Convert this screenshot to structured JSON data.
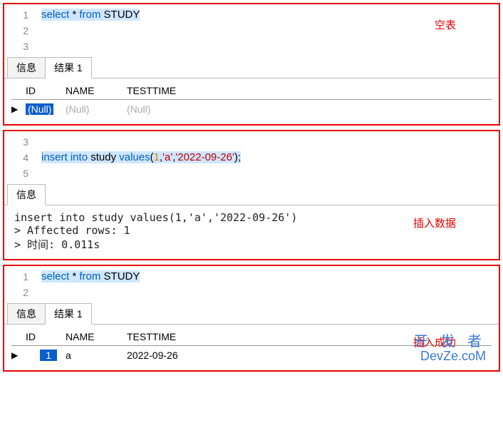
{
  "panel1": {
    "annotation": "空表",
    "sql": {
      "lines": [
        {
          "n": "1",
          "html": "<span class='sel'><span class='kw'>select</span> * <span class='kw'>from</span> STUDY</span>"
        },
        {
          "n": "2",
          "html": ""
        },
        {
          "n": "3",
          "html": ""
        }
      ]
    },
    "tabs": [
      "信息",
      "结果 1"
    ],
    "activeTab": 1,
    "headers": [
      "ID",
      "NAME",
      "TESTTIME"
    ],
    "row": [
      "(Null)",
      "(Null)",
      "(Null)"
    ]
  },
  "panel2": {
    "annotation": "插入数据",
    "sql": {
      "lines": [
        {
          "n": "3",
          "html": ""
        },
        {
          "n": "4",
          "html": "<span class='sel'><span class='kw'>insert into</span> study <span class='kw'>values</span>(<span class='num'>1</span>,<span class='str'>'a'</span>,<span class='str'>'2022-09-26'</span>);</span>"
        },
        {
          "n": "5",
          "html": ""
        }
      ]
    },
    "tabs": [
      "信息"
    ],
    "activeTab": 0,
    "msg": "insert into study values(1,'a','2022-09-26')\n> Affected rows: 1\n> 时间: 0.011s"
  },
  "panel3": {
    "annotation": "插入成功",
    "sql": {
      "lines": [
        {
          "n": "1",
          "html": "<span class='sel'><span class='kw'>select</span> * <span class='kw'>from</span> STUDY</span>"
        },
        {
          "n": "2",
          "html": ""
        }
      ]
    },
    "tabs": [
      "信息",
      "结果 1"
    ],
    "activeTab": 1,
    "headers": [
      "ID",
      "NAME",
      "TESTTIME"
    ],
    "row": [
      "1",
      "a",
      "2022-09-26"
    ]
  },
  "watermark": {
    "l1": "开 发 者",
    "l2": "DevZe.coM"
  }
}
